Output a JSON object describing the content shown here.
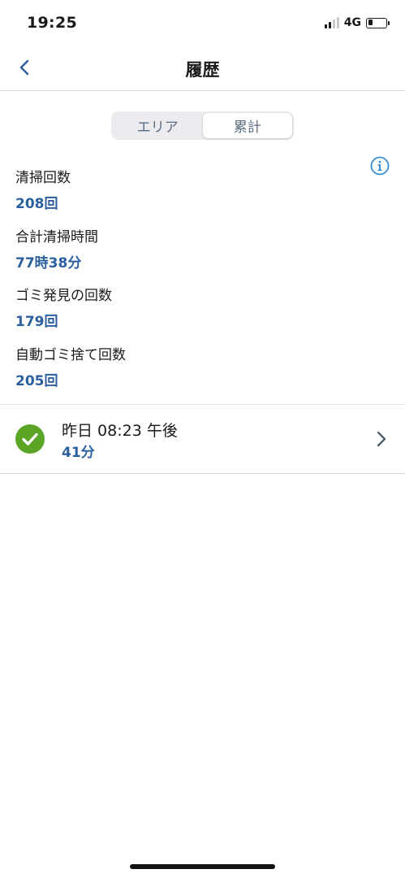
{
  "status_bar": {
    "time": "19:25",
    "network": "4G",
    "battery_level": 0.25
  },
  "nav": {
    "title": "履歴",
    "back_icon": "chevron-left-icon"
  },
  "segmented_control": {
    "options": [
      "エリア",
      "累計"
    ],
    "selected": "累計"
  },
  "stats": [
    {
      "label": "清掃回数",
      "value": "208回"
    },
    {
      "label": "合計清掃時間",
      "value": "77時38分"
    },
    {
      "label": "ゴミ発見の回数",
      "value": "179回"
    },
    {
      "label": "自動ゴミ捨て回数",
      "value": "205回"
    }
  ],
  "history": [
    {
      "title": "昨日 08:23 午後",
      "duration": "41分",
      "status": "completed"
    }
  ],
  "colors": {
    "accent": "#2c5f9e",
    "success": "#5aa526",
    "info_icon": "#3a8fd0"
  }
}
